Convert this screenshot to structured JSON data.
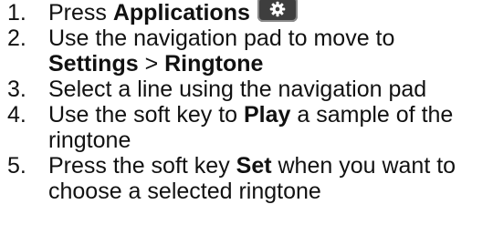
{
  "steps": [
    {
      "num": "1.",
      "pre": "Press ",
      "bold": "Applications",
      "icon": "gear-icon"
    },
    {
      "num": "2.",
      "line1": "Use the navigation pad to move to",
      "bold1": "Settings",
      "sep": " > ",
      "bold2": "Ringtone"
    },
    {
      "num": "3.",
      "text": "Select a line using the navigation pad"
    },
    {
      "num": "4.",
      "pre": "Use the soft key to ",
      "bold": "Play",
      "post": " a sample of the ringtone"
    },
    {
      "num": "5.",
      "pre": "Press the soft key ",
      "bold": "Set",
      "post": " when you want to choose a selected ringtone"
    }
  ]
}
